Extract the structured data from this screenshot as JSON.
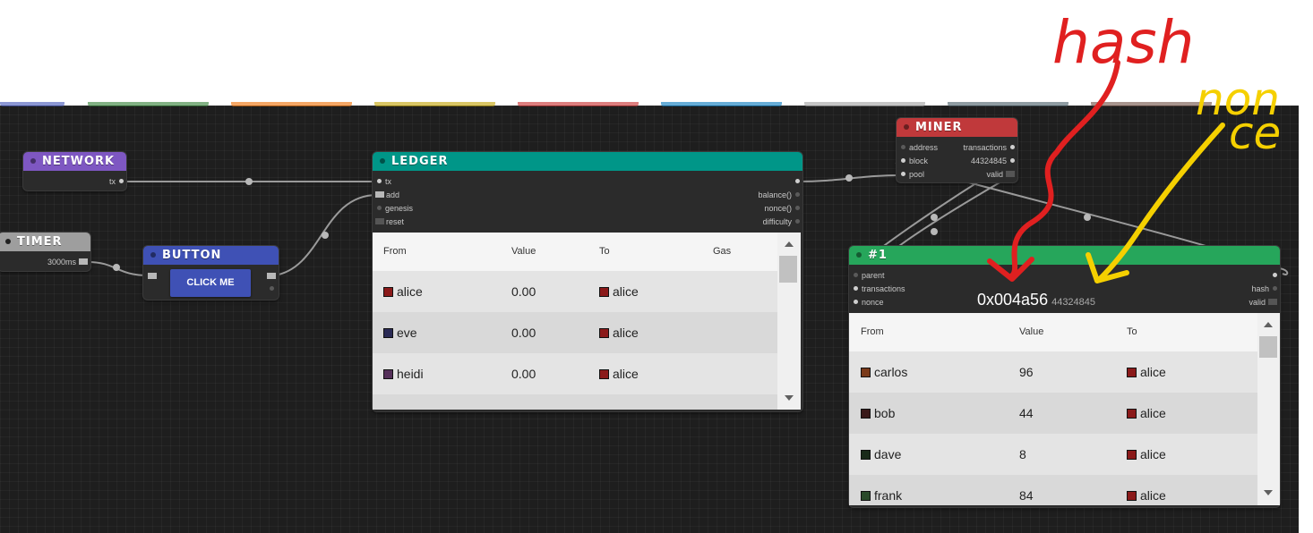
{
  "nodes": {
    "network": {
      "title": "NETWORK",
      "outputs": [
        "tx"
      ]
    },
    "timer": {
      "title": "TIMER",
      "outputs": [
        "3000ms"
      ]
    },
    "button": {
      "title": "BUTTON",
      "button_label": "CLICK ME"
    },
    "ledger": {
      "title": "LEDGER",
      "inputs": [
        "tx",
        "add",
        "genesis",
        "reset"
      ],
      "outputs": [
        "balance()",
        "nonce()",
        "difficulty"
      ],
      "columns": [
        "From",
        "Value",
        "To",
        "Gas"
      ],
      "rows": [
        {
          "from": "alice",
          "value": "0.00",
          "to": "alice",
          "from_color": "#8b1a1a",
          "to_color": "#8b1a1a"
        },
        {
          "from": "eve",
          "value": "0.00",
          "to": "alice",
          "from_color": "#2a2a55",
          "to_color": "#8b1a1a"
        },
        {
          "from": "heidi",
          "value": "0.00",
          "to": "alice",
          "from_color": "#55305a",
          "to_color": "#8b1a1a"
        }
      ]
    },
    "miner": {
      "title": "MINER",
      "inputs": [
        "address",
        "block",
        "pool"
      ],
      "outputs": [
        "transactions",
        "44324845",
        "valid"
      ]
    },
    "block": {
      "title": "#1",
      "inputs": [
        "parent",
        "transactions",
        "nonce"
      ],
      "outputs": [
        "hash",
        "valid"
      ],
      "hash": "0x004a56",
      "nonce": "44324845",
      "columns": [
        "From",
        "Value",
        "To"
      ],
      "rows": [
        {
          "from": "carlos",
          "value": "96",
          "to": "alice",
          "from_color": "#7a3a1a",
          "to_color": "#8b1a1a"
        },
        {
          "from": "bob",
          "value": "44",
          "to": "alice",
          "from_color": "#3a1a1a",
          "to_color": "#8b1a1a"
        },
        {
          "from": "dave",
          "value": "8",
          "to": "alice",
          "from_color": "#1a2a1a",
          "to_color": "#8b1a1a"
        },
        {
          "from": "frank",
          "value": "84",
          "to": "alice",
          "from_color": "#2a4a2a",
          "to_color": "#8b1a1a"
        }
      ]
    }
  },
  "annotations": {
    "hash": "hash",
    "nonce_line1": "non",
    "nonce_line2": "ce"
  },
  "colors": {
    "network": "#7e57c2",
    "timer": "#9e9e9e",
    "button": "#3f51b5",
    "ledger": "#009688",
    "miner": "#c0393b",
    "block": "#26a65b",
    "annotation_red": "#e02020",
    "annotation_yellow": "#f5d000"
  }
}
